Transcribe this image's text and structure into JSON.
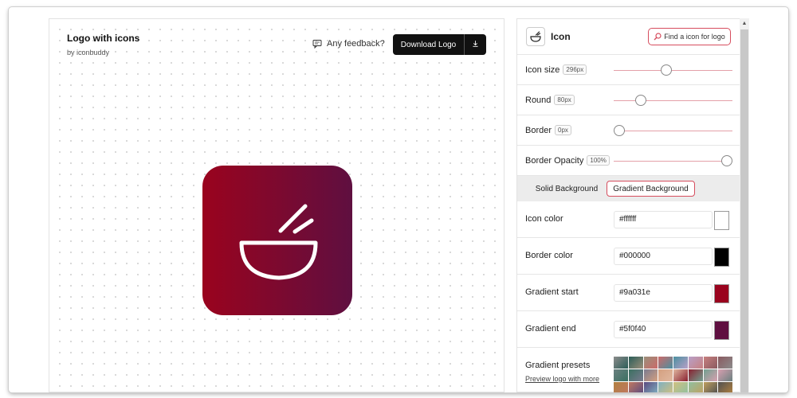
{
  "canvas": {
    "title": "Logo with icons",
    "byline": "by iconbuddy",
    "feedback": "Any feedback?",
    "download_label": "Download Logo",
    "download_icon": "download-arrow-icon",
    "logo_icon": "noodle-bowl-icon",
    "logo_gradient_start": "#9a031e",
    "logo_gradient_end": "#5f0f40"
  },
  "panel": {
    "title": "Icon",
    "find_button": "Find a icon for logo",
    "sliders": [
      {
        "label": "Icon size",
        "value": "296px",
        "fraction": 0.44
      },
      {
        "label": "Round",
        "value": "80px",
        "fraction": 0.23
      },
      {
        "label": "Border",
        "value": "0px",
        "fraction": 0.05
      },
      {
        "label": "Border Opacity",
        "value": "100%",
        "fraction": 0.95
      }
    ],
    "tabs": {
      "solid": "Solid Background",
      "gradient": "Gradient Background",
      "active": "gradient"
    },
    "colors": [
      {
        "label": "Icon color",
        "value": "#ffffff"
      },
      {
        "label": "Border color",
        "value": "#000000"
      },
      {
        "label": "Gradient start",
        "value": "#9a031e"
      },
      {
        "label": "Gradient end",
        "value": "#5f0f40"
      }
    ],
    "presets_label": "Gradient presets",
    "presets_link": "Preview logo with more",
    "preset_colors": [
      [
        "#8c8c8c",
        "#2b5d57",
        "#9a8f7a",
        "#cc6a6a",
        "#4a90a0",
        "#b8a0c8",
        "#c88080",
        "#8a5a60"
      ],
      [
        "#6a8080",
        "#3a7060",
        "#7a7a90",
        "#d4a080",
        "#e0b8a0",
        "#8a2030",
        "#70a090",
        "#d8a0b0"
      ],
      [
        "#b08040",
        "#c07860",
        "#5a4a80",
        "#80b0c0",
        "#d0c080",
        "#90c0a0",
        "#c0a060",
        "#505050"
      ]
    ]
  }
}
